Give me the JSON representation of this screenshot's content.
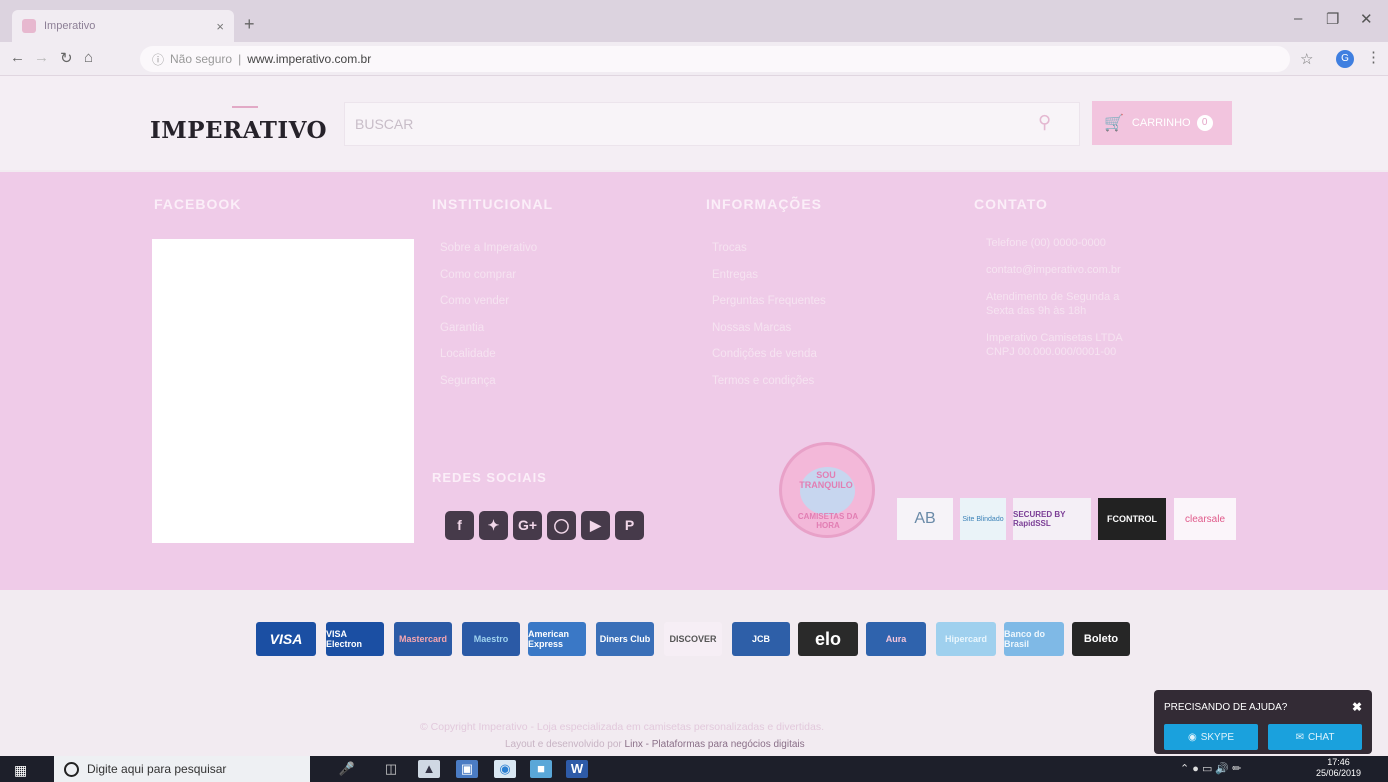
{
  "browser": {
    "tab_title": "Imperativo",
    "tab_close": "×",
    "new_tab": "+",
    "security_label": "Não seguro",
    "url": "www.imperativo.com.br",
    "profile_initial": "G"
  },
  "header": {
    "logo": "IMPERATIVO",
    "search_placeholder": "BUSCAR",
    "cart_label": "CARRINHO",
    "cart_count": "0"
  },
  "footer": {
    "facebook_title": "FACEBOOK",
    "institucional_title": "INSTITUCIONAL",
    "institucional_items": [
      "Sobre a Imperativo",
      "Como comprar",
      "Como vender",
      "Garantia",
      "Localidade",
      "Segurança"
    ],
    "informacoes_title": "INFORMAÇÕES",
    "informacoes_items": [
      "Trocas",
      "Entregas",
      "Perguntas Frequentes",
      "Nossas Marcas",
      "Condições de venda",
      "Termos e condições"
    ],
    "contato_title": "CONTATO",
    "contato_lines": [
      "Telefone (00) 0000-0000",
      "contato@imperativo.com.br",
      "Atendimento de Segunda a Sexta das 9h às 18h",
      "Imperativo Camisetas LTDA CNPJ 00.000.000/0001-00"
    ],
    "redes_sociais_title": "REDES SOCIAIS",
    "social_icons": [
      "facebook-icon",
      "twitter-icon",
      "google-plus-icon",
      "instagram-icon",
      "youtube-icon",
      "pinterest-icon"
    ],
    "seal_top": "SOU TRANQUILO",
    "seal_bottom": "CAMISETAS DA HORA",
    "badges": [
      "AB",
      "Site Blindado",
      "SECURED BY RapidSSL",
      "FCONTROL",
      "clearsale"
    ]
  },
  "payments": [
    "VISA",
    "VISA Electron",
    "Mastercard",
    "Maestro",
    "American Express",
    "Diners Club",
    "DISCOVER",
    "JCB",
    "elo",
    "Aura",
    "Hipercard",
    "Banco do Brasil",
    "Boleto"
  ],
  "copyright": {
    "line1": "© Copyright Imperativo - Loja especializada em camisetas personalizadas e divertidas.",
    "line2_prefix": "Layout e desenvolvido por",
    "line2_brand": "Linx - Plataformas para negócios digitais"
  },
  "help_widget": {
    "title": "PRECISANDO DE AJUDA?",
    "skype": "SKYPE",
    "chat": "CHAT",
    "close": "✖"
  },
  "taskbar": {
    "search_placeholder": "Digite aqui para pesquisar",
    "time": "17:46",
    "date": "25/06/2019"
  },
  "colors": {
    "footer_pink": "#efcbe8",
    "cart_pink": "#f2c4de",
    "help_blue": "#1aa1dd",
    "taskbar": "#1d1f2a"
  }
}
